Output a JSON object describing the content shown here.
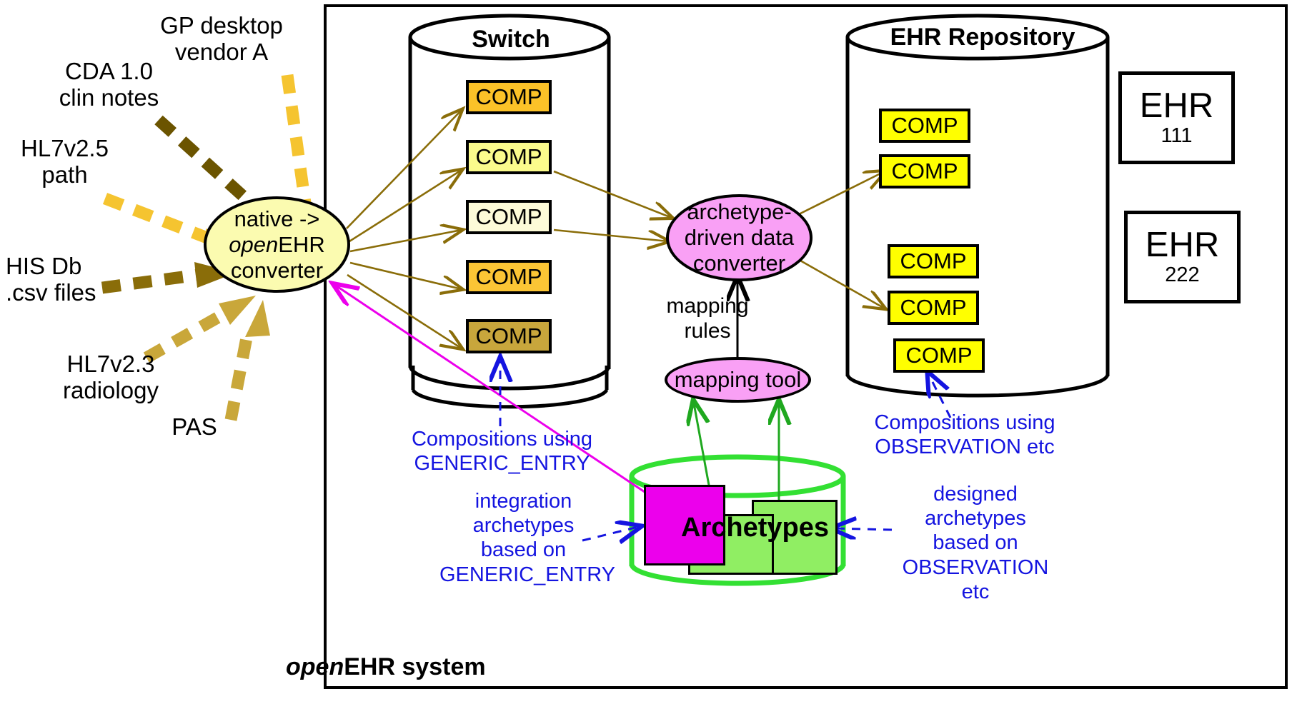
{
  "diagram": {
    "title": "openEHR integration architecture",
    "system_label_prefix": "open",
    "system_label_rest": "EHR system"
  },
  "sources": [
    {
      "name": "gp-desktop",
      "line1": "GP desktop",
      "line2": "vendor A",
      "color": "#f5c430"
    },
    {
      "name": "cda",
      "line1": "CDA 1.0",
      "line2": "clin notes",
      "color": "#6b5400"
    },
    {
      "name": "hl7v25",
      "line1": "HL7v2.5",
      "line2": "path",
      "color": "#f5c430"
    },
    {
      "name": "his-db",
      "line1": "HIS Db",
      "line2": ".csv files",
      "color": "#8a6d09"
    },
    {
      "name": "hl7v23",
      "line1": "HL7v2.3",
      "line2": "radiology",
      "color": "#c9a73a"
    },
    {
      "name": "pas",
      "line1": "PAS",
      "line2": "",
      "color": "#c9a73a"
    }
  ],
  "converter": {
    "line1": "native ->",
    "line2_em": "open",
    "line2_rest": "EHR",
    "line3": "converter",
    "fill": "#fbfbb0"
  },
  "switch": {
    "title": "Switch",
    "comps": [
      {
        "label": "COMP",
        "fill": "#fbc228"
      },
      {
        "label": "COMP",
        "fill": "#fbfb8c"
      },
      {
        "label": "COMP",
        "fill": "#fdfbd8"
      },
      {
        "label": "COMP",
        "fill": "#fbc535"
      },
      {
        "label": "COMP",
        "fill": "#c8a63c"
      }
    ]
  },
  "data_converter": {
    "line1": "archetype-",
    "line2": "driven data",
    "line3": "converter",
    "fill": "#f9a0f5"
  },
  "mapping_rules": {
    "line1": "mapping",
    "line2": "rules"
  },
  "mapping_tool": {
    "label": "mapping tool",
    "fill": "#f9a0f5"
  },
  "repository": {
    "title": "EHR Repository",
    "comps": [
      {
        "label": "COMP",
        "fill": "#ffff00"
      },
      {
        "label": "COMP",
        "fill": "#ffff00"
      },
      {
        "label": "COMP",
        "fill": "#ffff00"
      },
      {
        "label": "COMP",
        "fill": "#ffff00"
      },
      {
        "label": "COMP",
        "fill": "#ffff00"
      }
    ],
    "ehrs": [
      {
        "name": "EHR",
        "id": "111"
      },
      {
        "name": "EHR",
        "id": "222"
      }
    ]
  },
  "archetypes": {
    "label": "Archetypes",
    "cylinder_color": "#33e033",
    "card_magenta": "#ec00ec",
    "card_green": "#90ee63"
  },
  "notes": {
    "generic_entry_comp": "Compositions using\nGENERIC_ENTRY",
    "observation_comp": "Compositions using\nOBSERVATION etc",
    "integration": "integration\narchetypes\nbased on\nGENERIC_ENTRY",
    "designed": "designed\narchetypes\nbased on\nOBSERVATION\netc"
  },
  "colors": {
    "note_blue": "#1414e0",
    "arrow_olive": "#8a6d09",
    "magenta_line": "#ec00ec",
    "green_line": "#1fa81f"
  }
}
